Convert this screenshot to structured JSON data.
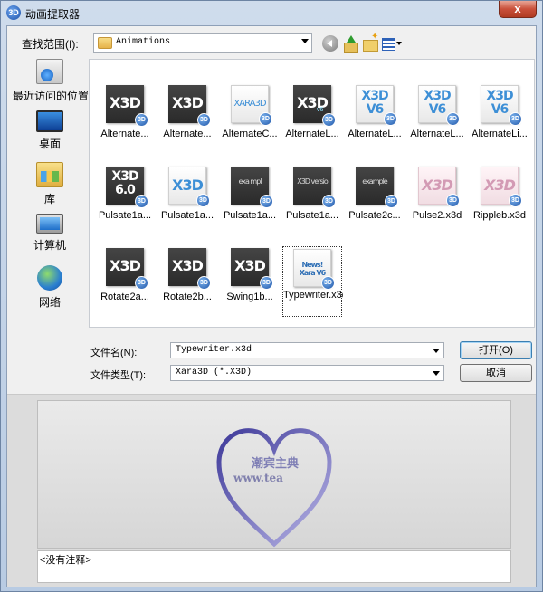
{
  "window": {
    "title": "动画提取器",
    "app_icon": "xara3d-logo-icon",
    "close_symbol": "x"
  },
  "toolbar": {
    "lookin_label": "查找范围(I):",
    "lookin_value": "Animations",
    "icons": [
      "back-icon",
      "up-folder-icon",
      "new-folder-icon",
      "view-menu-icon"
    ]
  },
  "places": [
    {
      "label": "最近访问的位置",
      "icon": "recent-places-icon"
    },
    {
      "label": "桌面",
      "icon": "desktop-icon"
    },
    {
      "label": "库",
      "icon": "libraries-icon"
    },
    {
      "label": "计算机",
      "icon": "computer-icon"
    },
    {
      "label": "网络",
      "icon": "network-icon"
    }
  ],
  "files": [
    {
      "name": "Alternate...",
      "thumb_text": "X3D",
      "sub": "",
      "style": "dark"
    },
    {
      "name": "Alternate...",
      "thumb_text": "X3D",
      "sub": "",
      "style": "dark"
    },
    {
      "name": "AlternateC...",
      "thumb_text": "XARA3D",
      "sub": "",
      "style": "light-small"
    },
    {
      "name": "AlternateL...",
      "thumb_text": "X3D",
      "sub": "v6",
      "style": "dark"
    },
    {
      "name": "AlternateL...",
      "thumb_text": "X3D V6",
      "sub": "",
      "style": "light-two"
    },
    {
      "name": "AlternateL...",
      "thumb_text": "X3D V6",
      "sub": "",
      "style": "light-two"
    },
    {
      "name": "AlternateLi...",
      "thumb_text": "X3D V6",
      "sub": "",
      "style": "light-two"
    },
    {
      "name": "Pulsate1a...",
      "thumb_text": "X3D 6.0",
      "sub": "",
      "style": "dark-two"
    },
    {
      "name": "Pulsate1a...",
      "thumb_text": "X3D",
      "sub": "",
      "style": "light"
    },
    {
      "name": "Pulsate1a...",
      "thumb_text": "exa mpl",
      "sub": "",
      "style": "dark-tiny"
    },
    {
      "name": "Pulsate1a...",
      "thumb_text": "X3D versio",
      "sub": "",
      "style": "dark-tiny"
    },
    {
      "name": "Pulsate2c...",
      "thumb_text": "example",
      "sub": "",
      "style": "dark-tiny"
    },
    {
      "name": "Pulse2.x3d",
      "thumb_text": "X3D",
      "sub": "",
      "style": "pink"
    },
    {
      "name": "Rippleb.x3d",
      "thumb_text": "X3D",
      "sub": "",
      "style": "pink"
    },
    {
      "name": "Rotate2a...",
      "thumb_text": "X3D",
      "sub": "",
      "style": "dark"
    },
    {
      "name": "Rotate2b...",
      "thumb_text": "X3D",
      "sub": "",
      "style": "dark"
    },
    {
      "name": "Swing1b...",
      "thumb_text": "X3D",
      "sub": "",
      "style": "dark"
    },
    {
      "name": "Typewriter.x3d",
      "thumb_text": "News! Xara V6",
      "sub": "",
      "style": "light-news",
      "selected": true
    }
  ],
  "badge_text": "3D",
  "form": {
    "filename_label": "文件名(N):",
    "filename_value": "Typewriter.x3d",
    "filetype_label": "文件类型(T):",
    "filetype_value": "Xara3D (*.X3D)",
    "open_button": "打开(O)",
    "cancel_button": "取消"
  },
  "preview": {
    "text_cn": "潮宾主典",
    "text_url": "www.tea",
    "heart_color": "#6b66b8",
    "comment": "<没有注释>"
  }
}
